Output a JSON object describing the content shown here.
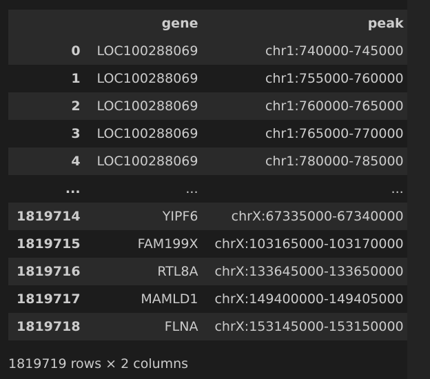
{
  "table": {
    "columns": [
      "",
      "gene",
      "peak"
    ],
    "rows": [
      [
        "0",
        "LOC100288069",
        "chr1:740000-745000"
      ],
      [
        "1",
        "LOC100288069",
        "chr1:755000-760000"
      ],
      [
        "2",
        "LOC100288069",
        "chr1:760000-765000"
      ],
      [
        "3",
        "LOC100288069",
        "chr1:765000-770000"
      ],
      [
        "4",
        "LOC100288069",
        "chr1:780000-785000"
      ],
      [
        "...",
        "...",
        "..."
      ],
      [
        "1819714",
        "YIPF6",
        "chrX:67335000-67340000"
      ],
      [
        "1819715",
        "FAM199X",
        "chrX:103165000-103170000"
      ],
      [
        "1819716",
        "RTL8A",
        "chrX:133645000-133650000"
      ],
      [
        "1819717",
        "MAMLD1",
        "chrX:149400000-149405000"
      ],
      [
        "1819718",
        "FLNA",
        "chrX:153145000-153150000"
      ]
    ]
  },
  "shape_text": "1819719 rows × 2 columns",
  "colors": {
    "background": "#1c1c1c",
    "row_stripe": "#2a2a2a",
    "text": "#cccccc"
  }
}
